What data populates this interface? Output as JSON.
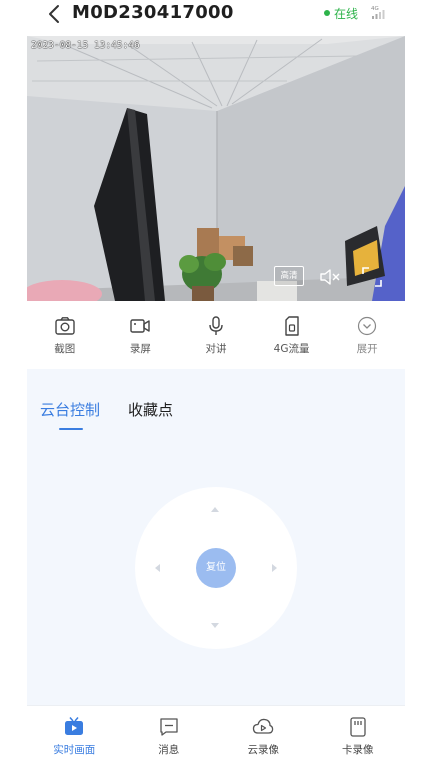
{
  "header": {
    "device_id": "M0D230417000",
    "status": "在线",
    "status_color": "#2db34a",
    "network_label": "4G"
  },
  "video": {
    "timestamp": "2023-08-15 13:45:46",
    "hd_label": "高清"
  },
  "toolbar": {
    "items": [
      {
        "label": "截图",
        "icon": "camera-icon"
      },
      {
        "label": "录屏",
        "icon": "video-record-icon"
      },
      {
        "label": "对讲",
        "icon": "microphone-icon"
      },
      {
        "label": "4G流量",
        "icon": "sim-card-icon"
      },
      {
        "label": "展开",
        "icon": "chevron-down-icon"
      }
    ]
  },
  "ptz": {
    "tabs": [
      "云台控制",
      "收藏点"
    ],
    "active_tab": "云台控制",
    "reset_label": "复位"
  },
  "bottom_nav": {
    "items": [
      {
        "label": "实时画面",
        "icon": "live-tv-icon",
        "active": true
      },
      {
        "label": "消息",
        "icon": "message-icon",
        "active": false
      },
      {
        "label": "云录像",
        "icon": "cloud-play-icon",
        "active": false
      },
      {
        "label": "卡录像",
        "icon": "sd-card-icon",
        "active": false
      }
    ]
  },
  "colors": {
    "accent": "#3a7de0",
    "panel_bg": "#f3f7fd",
    "reset_button": "#9bbcf0"
  }
}
